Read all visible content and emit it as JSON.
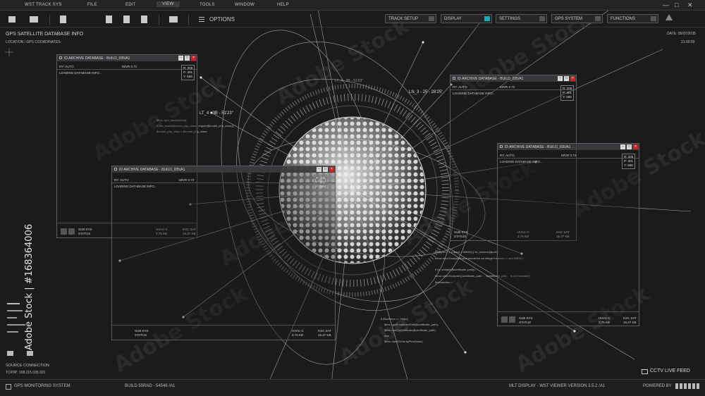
{
  "menubar": {
    "items": [
      "WST TRACK SYS",
      "FILE",
      "EDIT",
      "VIEW",
      "TOOLS",
      "WINDOW",
      "HELP"
    ],
    "active": "VIEW",
    "controls": [
      "—",
      "□",
      "✕"
    ]
  },
  "toolbar": {
    "icons": [
      "save-icon",
      "folder-icon",
      "document-icon",
      "document-edit-icon",
      "document-icon",
      "print-icon"
    ],
    "options_label": "OPTIONS"
  },
  "right_buttons": [
    {
      "label": "TRACK SETUP",
      "on": false
    },
    {
      "label": "DISPLAY",
      "on": true
    },
    {
      "label": "SETTINGS",
      "on": false
    },
    {
      "label": "GPS SYSTEM",
      "on": false
    },
    {
      "label": "FUNCTIONS",
      "on": false
    }
  ],
  "header": {
    "title": "GPS SATELLITE DATABASE INFO",
    "subtitle": "LOCATION / GPS COORDINATES:",
    "date": "DATE: 05/07/2035",
    "time": "21:00:00"
  },
  "coordinates": {
    "lt1": "LT_4 - 3B - 51'23\"",
    "ln1": "LN_3 - 25 - 28'25\"",
    "lt2": "LT_4 - 3B - 51'23\""
  },
  "windows": [
    {
      "title": "ID ARCHIVE DATABASE - BUILD_035/A1",
      "ry": "RY: AUTO",
      "mvr": "M/VR 0.72",
      "loading": "LOADING DATABASE INFO...",
      "readout": [
        "R: 205",
        "P: 301",
        "Y: 558"
      ],
      "sub1": "SUB SYS",
      "sub2": "STATUS",
      "hvac": "HVAC-C",
      "hval": "3.75 KB",
      "ksc": "KSC SAT",
      "kval": "15.37 KB"
    },
    {
      "title": "ID ARCHIVE DATABASE - BUILD_035/A1",
      "ry": "RY: AUTO",
      "mvr": "M/VR 0.72",
      "loading": "LOADING DATABASE INFO...",
      "readout": [
        "R: 205",
        "P: 301",
        "Y: 558"
      ],
      "sub1": "SUB SYS",
      "sub2": "STATUS",
      "hvac": "HVAC-C",
      "hval": "3.75 KB",
      "ksc": "KSC SAT",
      "kval": "15.37 KB"
    },
    {
      "title": "ID ARCHIVE DATABASE - BUILD_035/A1",
      "ry": "RY: AUTO",
      "mvr": "M/VR 0.72",
      "loading": "LOADING DATABASE INFO...",
      "readout": [
        "R: 205",
        "P: 301",
        "Y: 558"
      ],
      "sub1": "SUB SYS",
      "sub2": "STATUS",
      "hvac": "HVAC-C",
      "hval": "3.75 KB",
      "ksc": "KSC SAT",
      "kval": "15.37 KB"
    },
    {
      "title": "ID ARCHIVE DATABASE - BUILD_035/A1",
      "ry": "RY: AUTO",
      "mvr": "M/VR 0.72",
      "loading": "LOADING DATABASE INFO...",
      "readout": [
        "R: 205",
        "P: 301",
        "Y: 558"
      ],
      "sub1": "SUB SYS",
      "sub2": "STATUS",
      "hvac": "HVAC-C",
      "hval": "3.75 KB",
      "ksc": "KSC SAT",
      "kval": "15.37 KB"
    }
  ],
  "code": {
    "left": [
      "$this->get_sma(chmod);",
      "if (file_exists($model_php_class) require($model_php_class));",
      "$model_php_class = $model_php_class;"
    ],
    "right": [
      "if (($port < 1 || $port > 65535) || !is_numeric($port))",
      "throw new Exception('port should be an integer between 1 and 65535');",
      "if (is_writable($certificate_path))",
      "throw new Exception('certificate_path: ' . $certificate_path . ' is not readable');",
      "$connection = ' '",
      "if ($scheme == 'https')",
      "$this->getCertificatePath($certificate_path);",
      "$this->setCaCertificate($certificate_path);",
      "else",
      "$this->setSSLVerifyPeer(false);"
    ]
  },
  "footer": {
    "connection": "SOURCE CONNECTION",
    "ip": "TCP/IP: 168.215.035.001",
    "monitoring": "GPS MONITORING SYSTEM",
    "build": "BUILD 55RAD - 54546 /A1",
    "version": "MLT DISPLAY - WST VIEWER VERSION 3.5.2 /A1",
    "powered": "POWERED BY",
    "cctv": "CCTV LIVE FEED"
  },
  "watermark": {
    "brand": "Adobe Stock",
    "id": "#168364006"
  },
  "colors": {
    "accent": "#1fa7b3",
    "close": "#c62828",
    "background": "#1b1b1d"
  }
}
